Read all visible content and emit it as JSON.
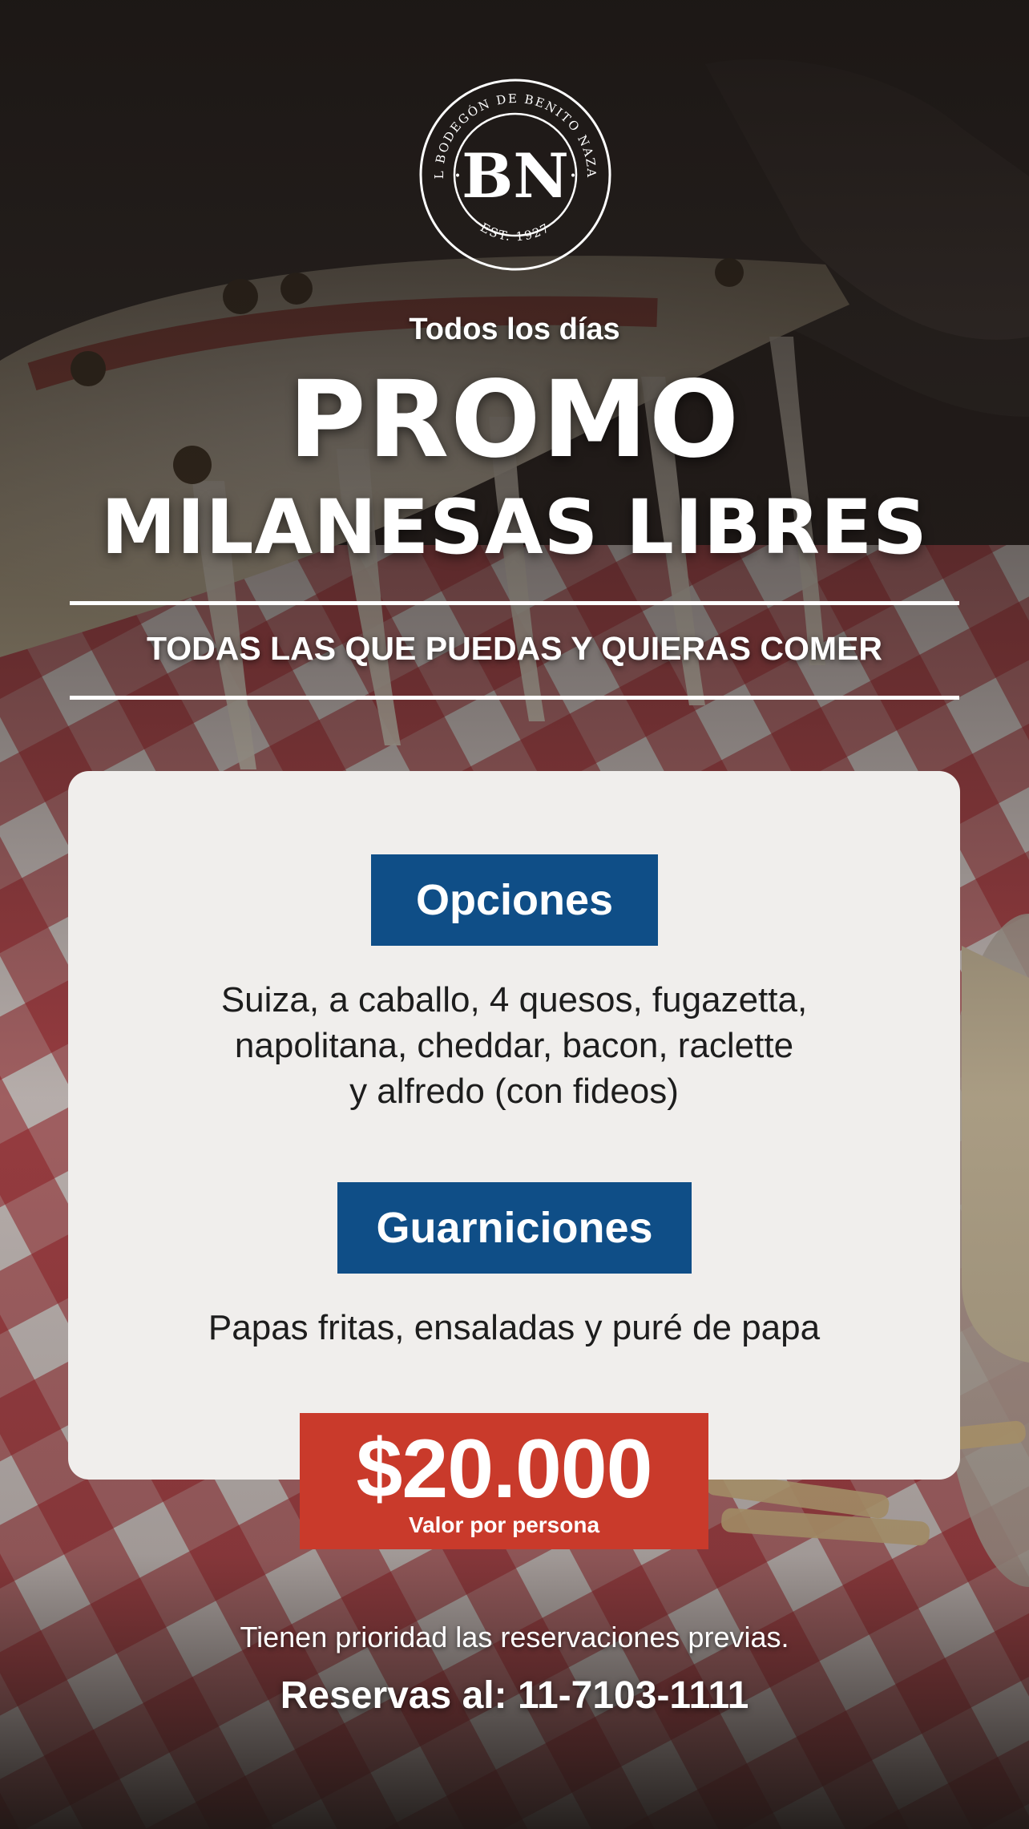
{
  "logo": {
    "monogram": "BN",
    "ring_text_top": "EL BODEGÓN DE BENITO NAZAR",
    "ring_text_bottom": "EST. 1927",
    "separator": "•"
  },
  "header": {
    "tagline": "Todos los días",
    "title": "PROMO",
    "subtitle": "MILANESAS LIBRES",
    "slogan": "TODAS LAS QUE PUEDAS Y QUIERAS COMER"
  },
  "sections": [
    {
      "label": "Opciones",
      "lines": [
        "Suiza, a caballo, 4 quesos, fugazetta,",
        "napolitana, cheddar, bacon, raclette",
        "y alfredo (con fideos)"
      ]
    },
    {
      "label": "Guarniciones",
      "lines": [
        "Papas fritas, ensaladas y puré de papa"
      ]
    }
  ],
  "price": {
    "amount": "$20.000",
    "caption": "Valor por persona"
  },
  "footer": {
    "note": "Tienen prioridad las reservaciones previas.",
    "contact_label": "Reservas al:",
    "contact_phone": "11-7103-1111"
  },
  "colors": {
    "section_label_bg": "#0f4e87",
    "price_bg": "#c93a2b",
    "card_bg": "#f0eeec",
    "tablecloth_red": "#b3212a"
  }
}
